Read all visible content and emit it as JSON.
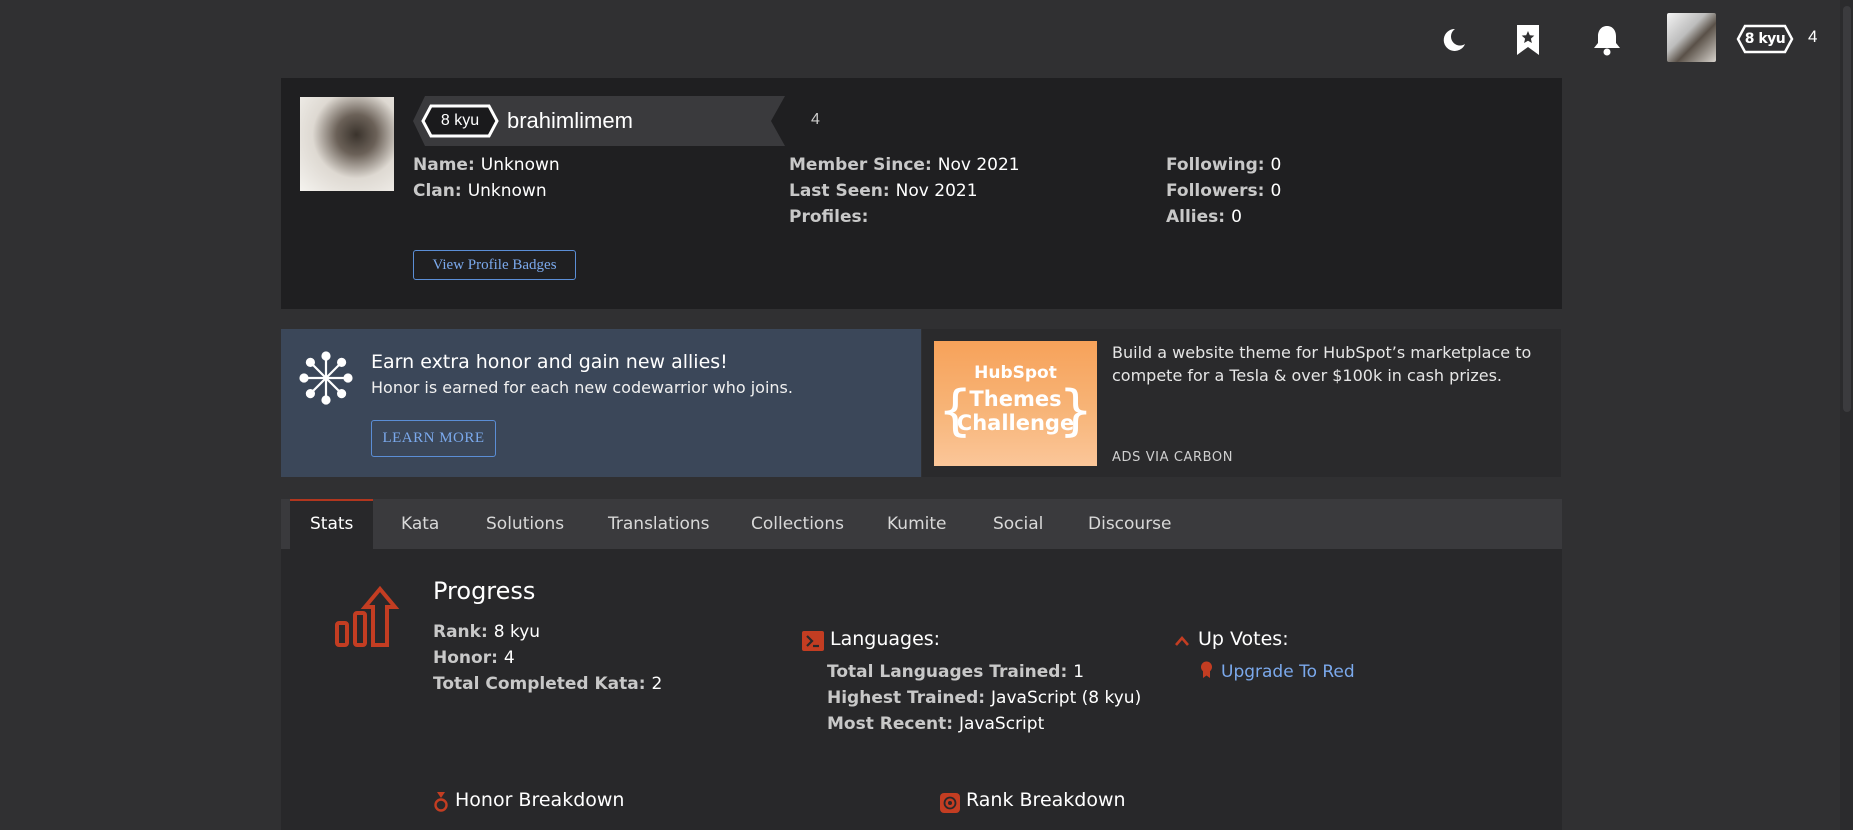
{
  "nav": {
    "rank_badge": "8 kyu",
    "honor": "4"
  },
  "profile": {
    "rank_badge": "8 kyu",
    "username": "brahimlimem",
    "honor": "4",
    "col1": [
      {
        "label": "Name:",
        "value": "Unknown"
      },
      {
        "label": "Clan:",
        "value": "Unknown"
      }
    ],
    "col2": [
      {
        "label": "Member Since:",
        "value": "Nov 2021"
      },
      {
        "label": "Last Seen:",
        "value": "Nov 2021"
      },
      {
        "label": "Profiles:",
        "value": ""
      }
    ],
    "col3": [
      {
        "label": "Following:",
        "value": "0"
      },
      {
        "label": "Followers:",
        "value": "0"
      },
      {
        "label": "Allies:",
        "value": "0"
      }
    ],
    "badges_button": "View Profile Badges"
  },
  "promo": {
    "title": "Earn extra honor and gain new allies!",
    "subtitle": "Honor is earned for each new codewarrior who joins.",
    "button": "LEARN MORE"
  },
  "ad": {
    "image_brand": "HubSpot",
    "image_title_1": "Themes",
    "image_title_2": "Challenge",
    "text": "Build a website theme for HubSpot’s marketplace to compete for a Tesla & over $100k in cash prizes.",
    "via": "ADS VIA CARBON"
  },
  "tabs": [
    "Stats",
    "Kata",
    "Solutions",
    "Translations",
    "Collections",
    "Kumite",
    "Social",
    "Discourse"
  ],
  "stats": {
    "progress_title": "Progress",
    "progress": [
      {
        "label": "Rank:",
        "value": "8 kyu"
      },
      {
        "label": "Honor:",
        "value": "4"
      },
      {
        "label": "Total Completed Kata:",
        "value": "2"
      }
    ],
    "languages_title": "Languages:",
    "languages": [
      {
        "label": "Total Languages Trained:",
        "value": "1"
      },
      {
        "label": "Highest Trained:",
        "value": "JavaScript (8 kyu)"
      },
      {
        "label": "Most Recent:",
        "value": "JavaScript"
      }
    ],
    "upvotes_title": "Up Votes:",
    "upgrade_link": "Upgrade To Red",
    "honor_breakdown": "Honor Breakdown",
    "rank_breakdown": "Rank Breakdown"
  },
  "colors": {
    "accent_red": "#b1361e",
    "link_blue": "#7ba9ec",
    "promo_bg": "#3b4759"
  }
}
